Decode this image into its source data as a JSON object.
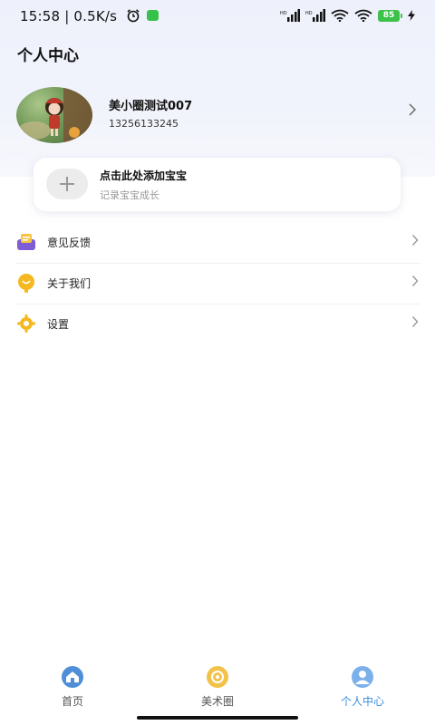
{
  "status_bar": {
    "time": "15:58",
    "net_speed": "| 0.5K/s",
    "battery": "85",
    "signal_label_1": "HD",
    "signal_label_2": "HD"
  },
  "header": {
    "title": "个人中心"
  },
  "profile": {
    "username": "美小圈测试007",
    "phone": "13256133245"
  },
  "add_baby": {
    "title": "点击此处添加宝宝",
    "subtitle": "记录宝宝成长"
  },
  "menu": {
    "items": [
      {
        "label": "意见反馈",
        "icon": "feedback-icon"
      },
      {
        "label": "关于我们",
        "icon": "about-icon"
      },
      {
        "label": "设置",
        "icon": "settings-icon"
      }
    ]
  },
  "tabs": [
    {
      "label": "首页",
      "icon": "home-icon"
    },
    {
      "label": "美术圈",
      "icon": "art-circle-icon"
    },
    {
      "label": "个人中心",
      "icon": "profile-icon",
      "active": true
    }
  ],
  "colors": {
    "accent": "#3a8de0",
    "hero_bg": "#eef1fb",
    "battery": "#3cc24b"
  }
}
